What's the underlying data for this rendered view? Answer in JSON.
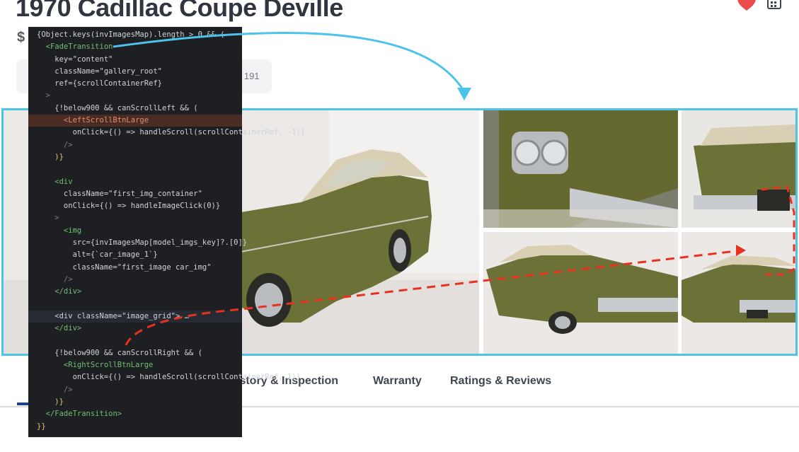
{
  "listing": {
    "title": "1970 Cadillac Coupe Deville",
    "price_prefix": "$",
    "stock_label": "# 191"
  },
  "tabs": [
    {
      "label": "istory & Inspection"
    },
    {
      "label": "Warranty"
    },
    {
      "label": "Ratings & Reviews"
    }
  ],
  "icons": {
    "favorite": "heart-icon",
    "calendar": "calendar-icon"
  },
  "code": {
    "lines": [
      "{Object.keys(invImagesMap).length > 0 && (",
      "  <FadeTransition",
      "    key=\"content\"",
      "    className=\"gallery_root\"",
      "    ref={scrollContainerRef}",
      "  >",
      "    {!below900 && canScrollLeft && (",
      "      <LeftScrollBtnLarge",
      "        onClick={() => handleScroll(scrollContainerRef, -1)}",
      "      />",
      "    )}",
      "",
      "    <div",
      "      className=\"first_img_container\"",
      "      onClick={() => handleImageClick(0)}",
      "    >",
      "      <img",
      "        src={invImagesMap[model_imgs_key]?.[0]}",
      "        alt={`car_image_1`}",
      "        className=\"first_image car_img\"",
      "      />",
      "    </div>",
      "",
      "    <div className=\"image_grid\"> …",
      "    </div>",
      "",
      "    {!below900 && canScrollRight && (",
      "      <RightScrollBtnLarge",
      "        onClick={() => handleScroll(scrollContainerRef, 1)}",
      "      />",
      "    )}",
      "  </FadeTransition>",
      "}}"
    ]
  },
  "colors": {
    "highlight_border": "#4cc3ea",
    "annotation_arrow": "#4cc3ea",
    "dashed_connector": "#e8321e",
    "active_tab": "#1d3f9a",
    "car_body": "#6b7137",
    "car_roof": "#d8cfb4"
  }
}
